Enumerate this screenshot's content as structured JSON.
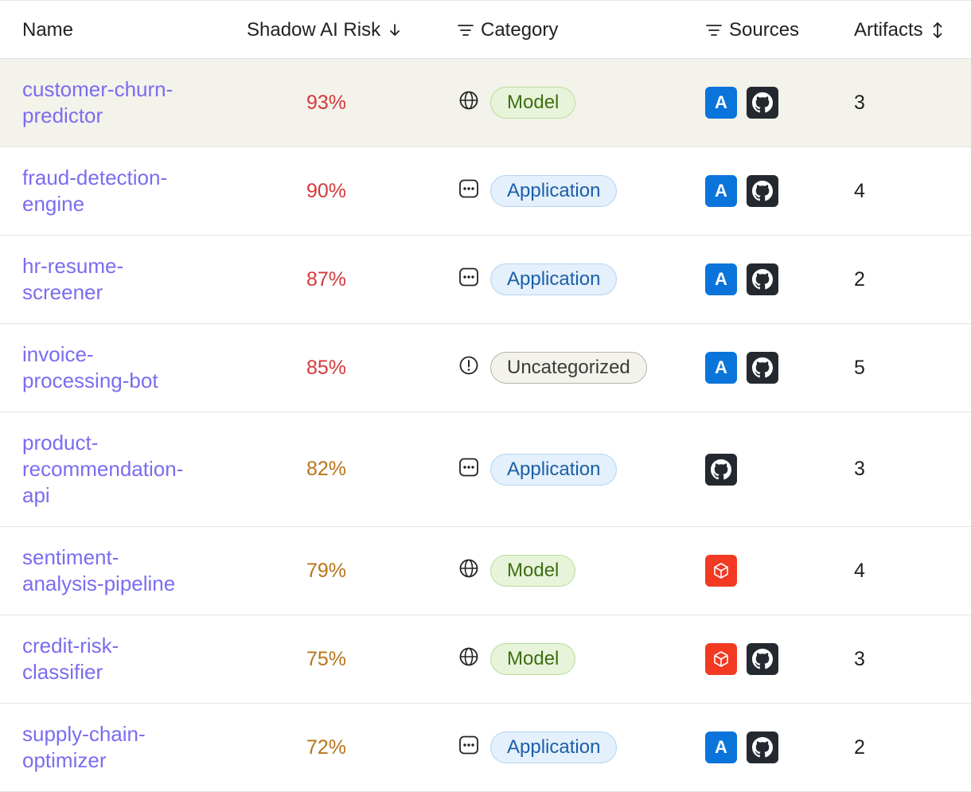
{
  "header": {
    "name": "Name",
    "risk": "Shadow AI Risk",
    "category": "Category",
    "sources": "Sources",
    "artifacts": "Artifacts"
  },
  "rows": [
    {
      "name1": "customer-churn-",
      "name2": "predictor",
      "name3": "",
      "risk": "93%",
      "level": "high",
      "category": "Model",
      "cat_icon": "globe-icon",
      "sources": [
        "azure",
        "github"
      ],
      "artifacts": "3"
    },
    {
      "name1": "fraud-detection-",
      "name2": "engine",
      "name3": "",
      "risk": "90%",
      "level": "high",
      "category": "Application",
      "cat_icon": "chat-icon",
      "sources": [
        "azure",
        "github"
      ],
      "artifacts": "4"
    },
    {
      "name1": "hr-resume-",
      "name2": "screener",
      "name3": "",
      "risk": "87%",
      "level": "high",
      "category": "Application",
      "cat_icon": "chat-icon",
      "sources": [
        "azure",
        "github"
      ],
      "artifacts": "2"
    },
    {
      "name1": "invoice-",
      "name2": "processing-bot",
      "name3": "",
      "risk": "85%",
      "level": "high",
      "category": "Uncategorized",
      "cat_icon": "alert-icon",
      "sources": [
        "azure",
        "github"
      ],
      "artifacts": "5"
    },
    {
      "name1": "product-",
      "name2": "recommendation-",
      "name3": "api",
      "risk": "82%",
      "level": "med",
      "category": "Application",
      "cat_icon": "chat-icon",
      "sources": [
        "github"
      ],
      "artifacts": "3"
    },
    {
      "name1": "sentiment-",
      "name2": "analysis-pipeline",
      "name3": "",
      "risk": "79%",
      "level": "med",
      "category": "Model",
      "cat_icon": "globe-icon",
      "sources": [
        "aws-box"
      ],
      "artifacts": "4"
    },
    {
      "name1": "credit-risk-",
      "name2": "classifier",
      "name3": "",
      "risk": "75%",
      "level": "med",
      "category": "Model",
      "cat_icon": "globe-icon",
      "sources": [
        "aws-box",
        "github"
      ],
      "artifacts": "3"
    },
    {
      "name1": "supply-chain-",
      "name2": "optimizer",
      "name3": "",
      "risk": "72%",
      "level": "med",
      "category": "Application",
      "cat_icon": "chat-icon",
      "sources": [
        "azure",
        "github"
      ],
      "artifacts": "2"
    }
  ],
  "colors": {
    "name_link": "#7b6cf0",
    "risk_high": "#d4393b",
    "risk_med": "#b8741a",
    "selected_row_bg": "#f3f2eb",
    "azure": "#0a74db",
    "github": "#24292f",
    "aws_box": "#f23a22"
  },
  "selected_row": 0,
  "sort": {
    "column": "risk",
    "direction": "desc"
  }
}
